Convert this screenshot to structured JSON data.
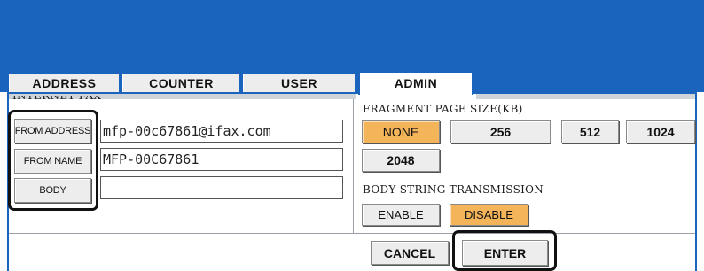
{
  "tabs": [
    {
      "label": "ADDRESS",
      "active": false
    },
    {
      "label": "COUNTER",
      "active": false
    },
    {
      "label": "USER",
      "active": false
    },
    {
      "label": "ADMIN",
      "active": true
    }
  ],
  "internet_fax": {
    "section_label": "INTERNET FAX",
    "from_address": {
      "button_label": "FROM ADDRESS",
      "value": "mfp-00c67861@ifax.com"
    },
    "from_name": {
      "button_label": "FROM NAME",
      "value": "MFP-00C67861"
    },
    "body": {
      "button_label": "BODY",
      "value": ""
    }
  },
  "fragment_page_size": {
    "label": "FRAGMENT PAGE SIZE(KB)",
    "options": [
      "NONE",
      "256",
      "512",
      "1024",
      "2048"
    ],
    "selected": "NONE"
  },
  "body_string_transmission": {
    "label": "BODY STRING TRANSMISSION",
    "options": [
      "ENABLE",
      "DISABLE"
    ],
    "selected": "DISABLE"
  },
  "footer": {
    "cancel_label": "CANCEL",
    "enter_label": "ENTER"
  },
  "colors": {
    "header_blue": "#1a64bd",
    "selected_orange": "#f3b45a",
    "button_gray": "#ededed"
  }
}
